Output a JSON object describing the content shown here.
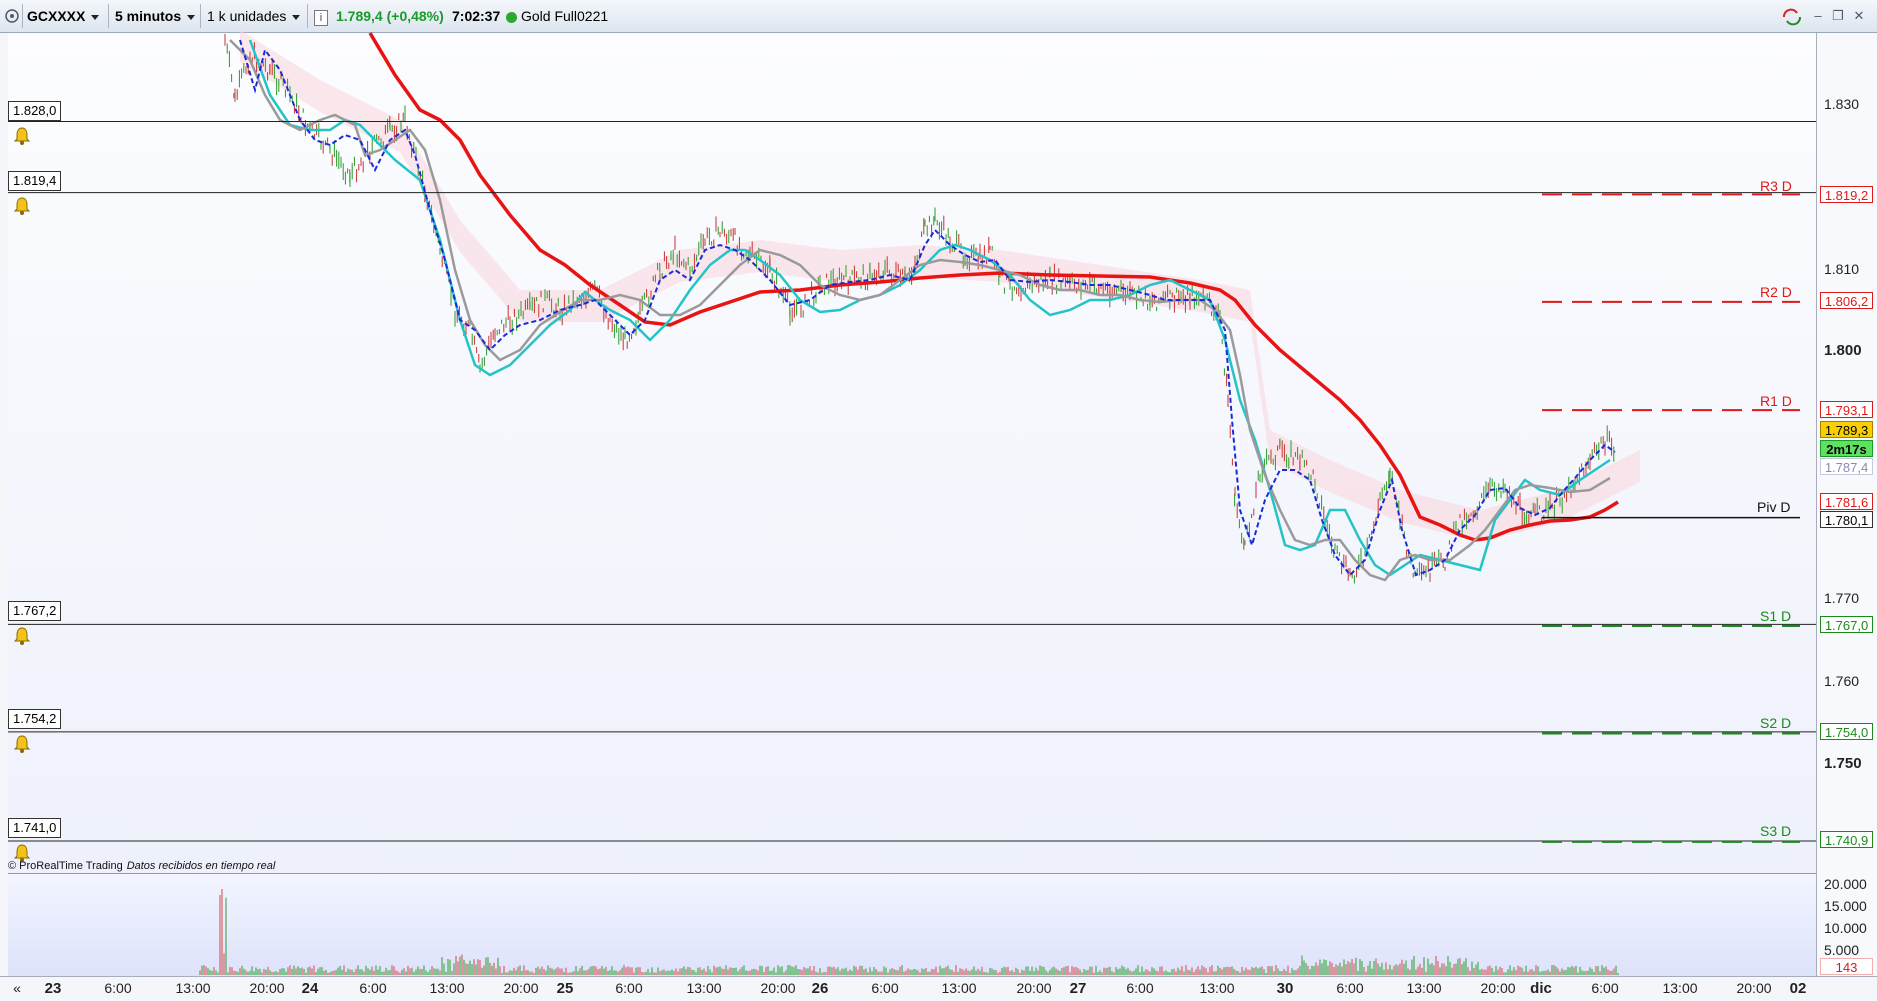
{
  "toolbar": {
    "instrument": "GCXXXX",
    "timeframe": "5 minutos",
    "units": "1 k unidades",
    "info_icon": "i",
    "price_text": "1.789,4 (+0,48%)",
    "time_text": "7:02:37",
    "contract": "Gold Full0221"
  },
  "colors": {
    "price_up": "#1a9a2a",
    "resistance": "#e01818",
    "support": "#1a8a1a",
    "sma_red": "#e81414",
    "ma_cyan": "#22c4c8",
    "ma_gray": "#9a9a9a",
    "ma_blue_dashed": "#1a2ad8"
  },
  "price_axis": {
    "ticks": [
      {
        "label": "1.830",
        "bold": false
      },
      {
        "label": "1.810",
        "bold": false
      },
      {
        "label": "1.800",
        "bold": true
      },
      {
        "label": "1.770",
        "bold": false
      },
      {
        "label": "1.760",
        "bold": false
      },
      {
        "label": "1.750",
        "bold": true
      }
    ],
    "volume_ticks": [
      "20.000",
      "15.000",
      "10.000",
      "5.000"
    ]
  },
  "alerts": [
    {
      "label": "1.828,0"
    },
    {
      "label": "1.819,4"
    },
    {
      "label": "1.767,2"
    },
    {
      "label": "1.754,2"
    },
    {
      "label": "1.741,0"
    }
  ],
  "pivots": [
    {
      "name": "R3 D",
      "value": "1.819,2",
      "type": "resistance"
    },
    {
      "name": "R2 D",
      "value": "1.806,2",
      "type": "resistance"
    },
    {
      "name": "R1 D",
      "value": "1.793,1",
      "type": "resistance"
    },
    {
      "name": "Piv D",
      "value": "1.780,1",
      "type": "pivot"
    },
    {
      "name": "S1 D",
      "value": "1.767,0",
      "type": "support"
    },
    {
      "name": "S2 D",
      "value": "1.754,0",
      "type": "support"
    },
    {
      "name": "S3 D",
      "value": "1.740,9",
      "type": "support"
    }
  ],
  "current_tags": {
    "last_price": "1.789,3",
    "countdown": "2m17s",
    "bid": "1.787,4",
    "sma": "1.781,6",
    "volume_last": "143"
  },
  "footer": {
    "brand": "© ProRealTime Trading",
    "status": "Datos recibidos en tiempo real"
  },
  "time_axis": [
    {
      "label": "«",
      "bold": false
    },
    {
      "label": "23",
      "bold": true
    },
    {
      "label": "6:00",
      "bold": false
    },
    {
      "label": "13:00",
      "bold": false
    },
    {
      "label": "20:00",
      "bold": false
    },
    {
      "label": "24",
      "bold": true
    },
    {
      "label": "6:00",
      "bold": false
    },
    {
      "label": "13:00",
      "bold": false
    },
    {
      "label": "20:00",
      "bold": false
    },
    {
      "label": "25",
      "bold": true
    },
    {
      "label": "6:00",
      "bold": false
    },
    {
      "label": "13:00",
      "bold": false
    },
    {
      "label": "20:00",
      "bold": false
    },
    {
      "label": "26",
      "bold": true
    },
    {
      "label": "6:00",
      "bold": false
    },
    {
      "label": "13:00",
      "bold": false
    },
    {
      "label": "20:00",
      "bold": false
    },
    {
      "label": "27",
      "bold": true
    },
    {
      "label": "6:00",
      "bold": false
    },
    {
      "label": "13:00",
      "bold": false
    },
    {
      "label": "30",
      "bold": true
    },
    {
      "label": "6:00",
      "bold": false
    },
    {
      "label": "13:00",
      "bold": false
    },
    {
      "label": "20:00",
      "bold": false
    },
    {
      "label": "dic",
      "bold": true
    },
    {
      "label": "6:00",
      "bold": false
    },
    {
      "label": "13:00",
      "bold": false
    },
    {
      "label": "20:00",
      "bold": false
    },
    {
      "label": "02",
      "bold": true
    }
  ]
}
